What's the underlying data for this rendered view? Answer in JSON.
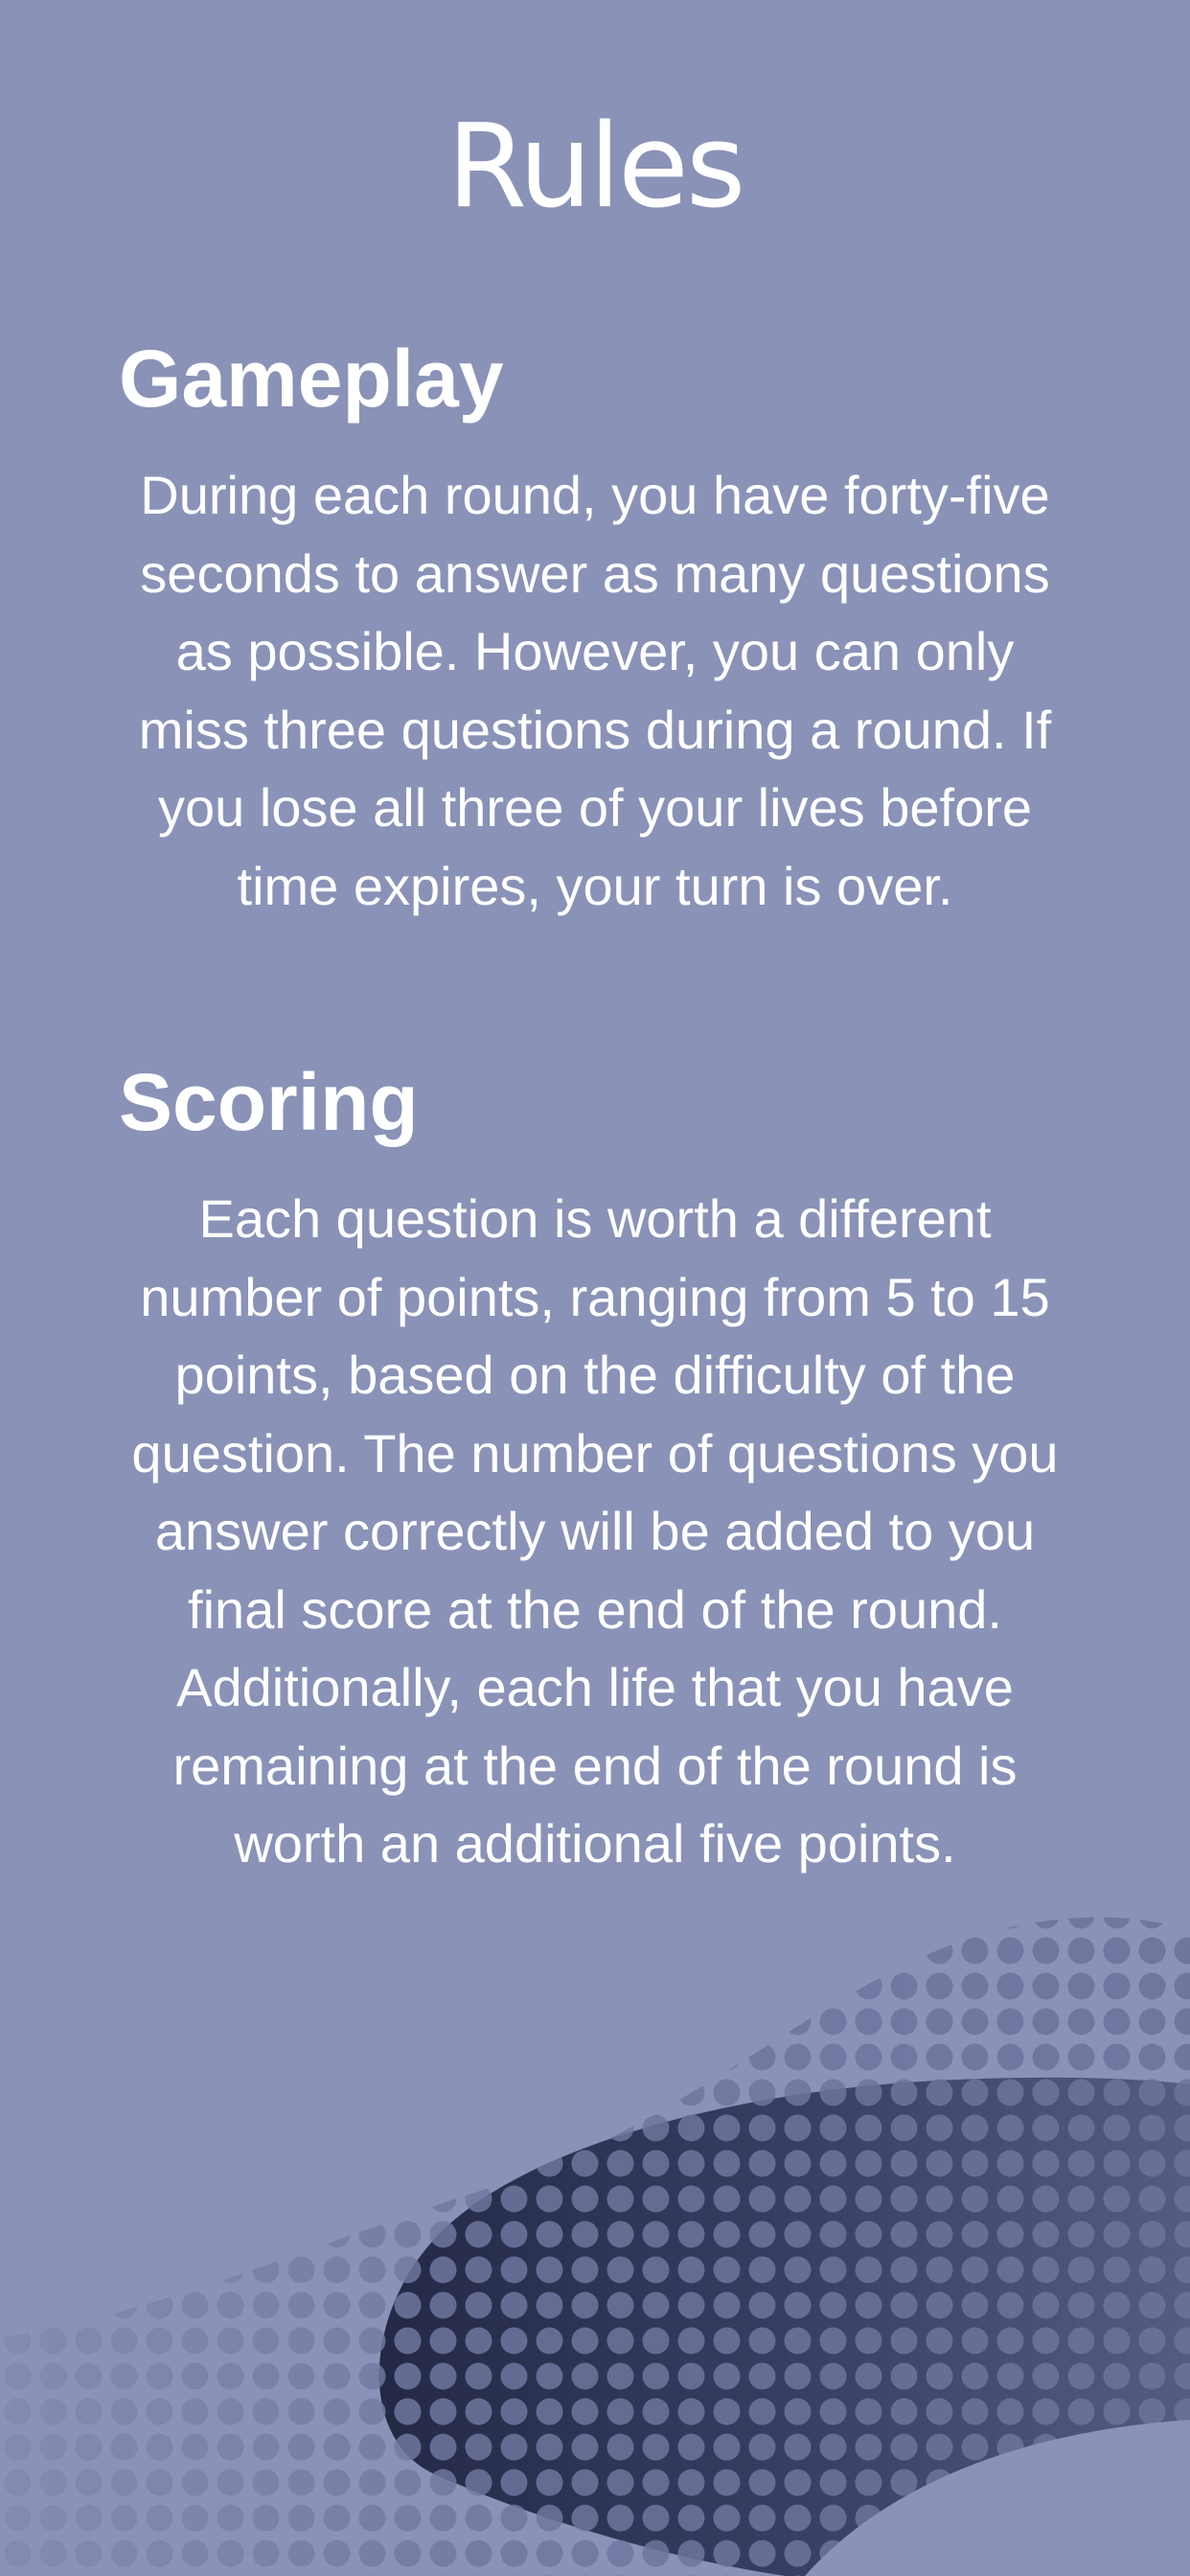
{
  "title": "Rules",
  "sections": [
    {
      "heading": "Gameplay",
      "body": "During each round, you have forty-five seconds to answer as many questions as possible. However, you can only miss three questions during a round. If you lose all three of your lives before time expires, your turn is over."
    },
    {
      "heading": "Scoring",
      "body": "Each question is worth a different number of points, ranging from 5 to 15 points, based on the difficulty of the question. The number of questions you answer correctly will be added to you final score at the end of the round. Additionally, each life that you have remaining at the end of the round is worth an additional five points."
    }
  ],
  "colors": {
    "background": "#8a92b7",
    "text": "#ffffff",
    "wave_light": "#a3aacb",
    "wave_dark": "#2a2f4e"
  }
}
